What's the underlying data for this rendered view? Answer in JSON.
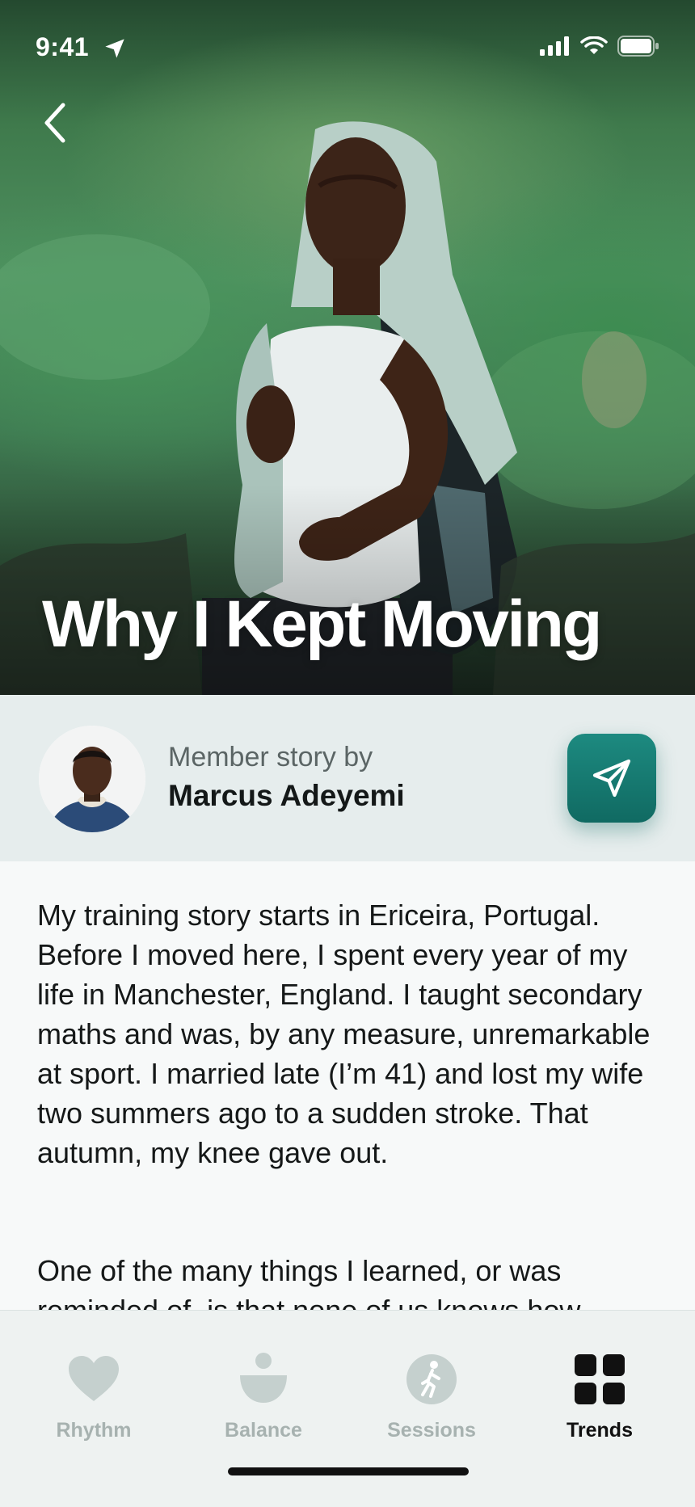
{
  "status_bar": {
    "time": "9:41",
    "icons": [
      "location-arrow-icon",
      "cellular-signal-icon",
      "wifi-icon",
      "battery-icon"
    ]
  },
  "hero": {
    "title": "Why I Kept Moving",
    "back_icon": "chevron-left-icon"
  },
  "author": {
    "kicker": "Member story by",
    "name": "Marcus Adeyemi",
    "share_icon": "paper-plane-icon"
  },
  "story": {
    "paragraphs": [
      "My training story starts in Ericeira, Portugal. Before I moved here, I spent every year of my life in Manchester, England. I taught secondary maths and was, by any measure, unremarkable at sport. I married late (I’m 41) and lost my wife two summers ago to a sudden stroke. That autumn, my knee gave out.",
      "One of the many things I learned, or was reminded of, is that none of us knows how"
    ]
  },
  "tab_bar": {
    "active": "Trends",
    "tabs": [
      {
        "label": "Rhythm",
        "icon": "heart-icon"
      },
      {
        "label": "Balance",
        "icon": "balance-icon"
      },
      {
        "label": "Sessions",
        "icon": "walking-person-icon"
      },
      {
        "label": "Trends",
        "icon": "grid-icon"
      }
    ]
  },
  "colors": {
    "accent": "#106a62",
    "tab_inactive": "#a7b2b0",
    "author_card_bg": "#e6eded"
  }
}
